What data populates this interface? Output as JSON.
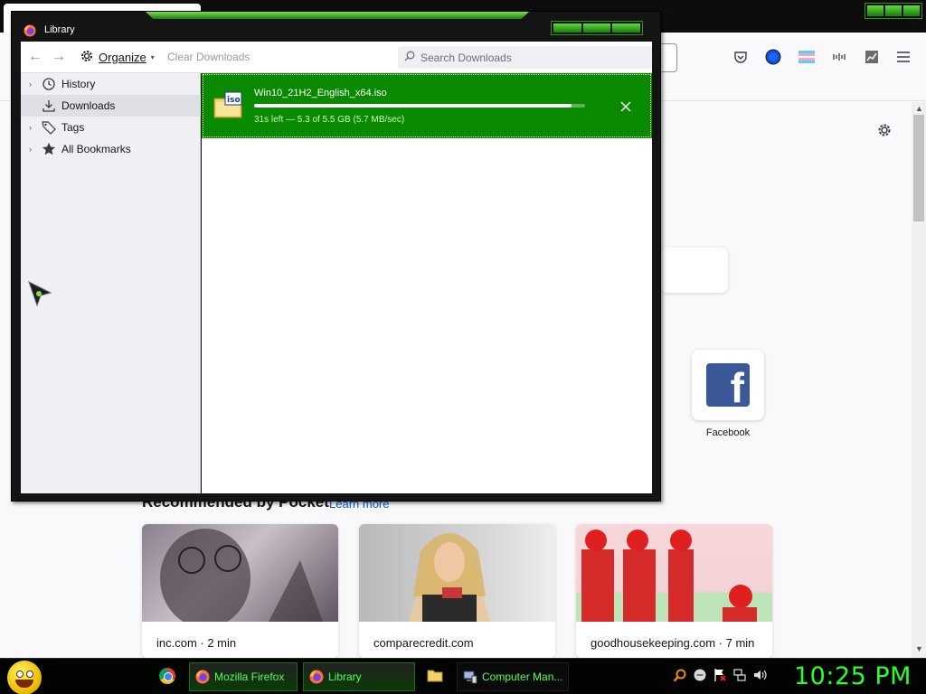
{
  "library": {
    "title": "Library",
    "toolbar": {
      "organize_label": "Organize",
      "clear_downloads_label": "Clear Downloads",
      "search_placeholder": "Search Downloads"
    },
    "sidebar": {
      "items": [
        {
          "label": "History",
          "icon": "clock-icon",
          "expandable": true,
          "selected": false
        },
        {
          "label": "Downloads",
          "icon": "download-icon",
          "expandable": false,
          "selected": true
        },
        {
          "label": "Tags",
          "icon": "tag-icon",
          "expandable": true,
          "selected": false
        },
        {
          "label": "All Bookmarks",
          "icon": "star-icon",
          "expandable": true,
          "selected": false
        }
      ]
    },
    "downloads": [
      {
        "filename": "Win10_21H2_English_x64.iso",
        "status": "31s left — 5.3 of 5.5 GB (5.7 MB/sec)",
        "progress_fraction": 0.96,
        "icon": "iso-file-icon"
      }
    ]
  },
  "firefox": {
    "shortcuts": [
      {
        "label": "Facebook",
        "icon": "facebook-icon"
      }
    ],
    "pocket": {
      "heading": "Recommended by Pocket",
      "learn_more": "Learn more",
      "cards": [
        {
          "source": "inc.com · 2 min"
        },
        {
          "source": "comparecredit.com"
        },
        {
          "source": "goodhousekeeping.com · 7 min"
        }
      ]
    }
  },
  "taskbar": {
    "tasks": [
      {
        "label": "Mozilla Firefox",
        "icon": "firefox-icon",
        "active": true
      },
      {
        "label": "Library",
        "icon": "firefox-icon",
        "active": true
      },
      {
        "label": "Computer Man...",
        "icon": "computer-management-icon",
        "active": false
      }
    ],
    "clock": "10:25 PM"
  },
  "colors": {
    "download_highlight": "#0a8a00",
    "taskbar_text": "#55ff55",
    "clock": "#2bff2b"
  }
}
